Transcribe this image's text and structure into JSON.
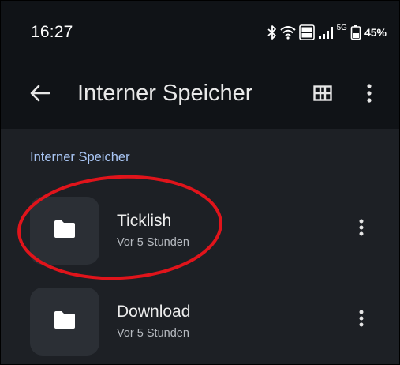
{
  "status_bar": {
    "time": "16:27",
    "network": "5G",
    "battery": "45%",
    "icons": [
      "bluetooth-icon",
      "wifi-icon",
      "volte-icon",
      "signal-icon",
      "battery-icon"
    ]
  },
  "app_bar": {
    "title": "Interner Speicher",
    "back_icon": "arrow-left-icon",
    "view_toggle_icon": "grid-view-icon",
    "more_icon": "more-vert-icon"
  },
  "breadcrumb": {
    "label": "Interner Speicher"
  },
  "items": [
    {
      "name": "Ticklish",
      "date": "Vor 5 Stunden",
      "icon": "folder-icon",
      "highlighted": true
    },
    {
      "name": "Download",
      "date": "Vor 5 Stunden",
      "icon": "folder-icon",
      "highlighted": false
    }
  ],
  "colors": {
    "background": "#1d2025",
    "app_bar": "#101317",
    "folder_tile": "#2b2f35",
    "breadcrumb": "#a9c6f5",
    "annotation": "#e0141b"
  }
}
